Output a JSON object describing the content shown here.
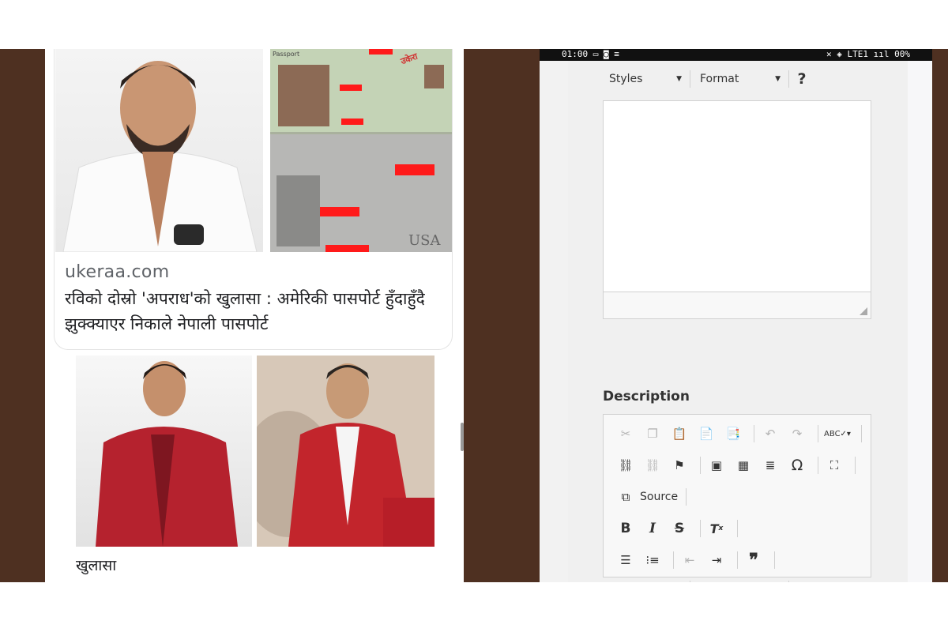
{
  "statusbar": {
    "left": "01:00 ▭ ◙ ≡",
    "right": "✕ ◈ LTE1 ııl 00%"
  },
  "article": {
    "site": "ukeraa.com",
    "headline": "रविको दोस्रो 'अपराध'को खुलासा : अमेरिकी पासपोर्ट हुँदाहुँदै झुक्क्याएर निकाले नेपाली पासपोर्ट",
    "stamp": "उकेरा",
    "passport_top": "Passport",
    "passport_usa": "USA"
  },
  "gallery": {
    "caption": "खुलासा"
  },
  "editor": {
    "styles_label": "Styles",
    "format_label": "Format",
    "help_label": "?",
    "description_label": "Description",
    "source_label": "Source"
  }
}
